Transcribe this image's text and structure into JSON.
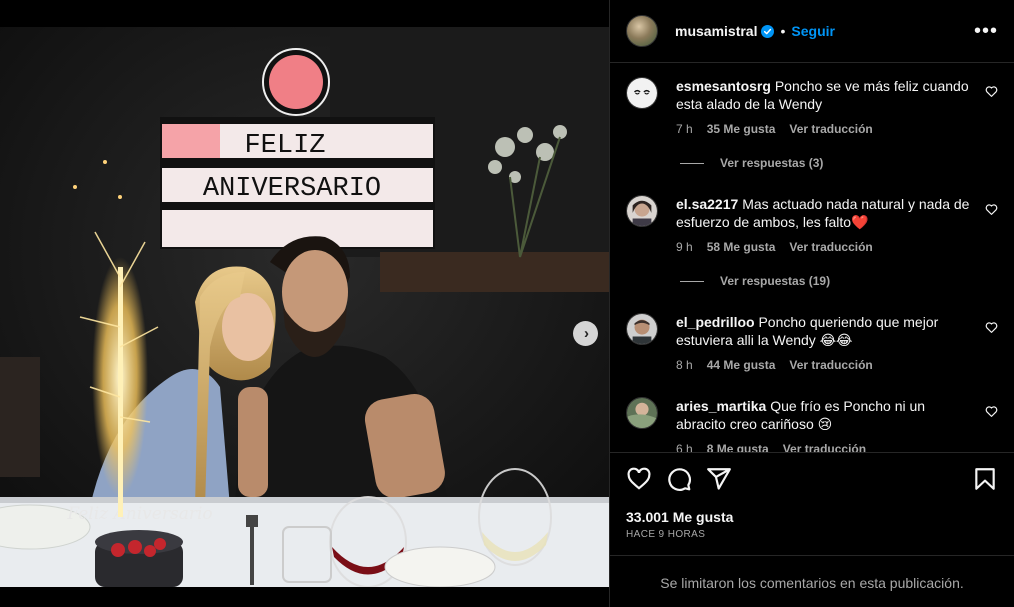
{
  "post": {
    "username": "musamistral",
    "follow_label": "Seguir",
    "dot": "•",
    "more_label": "•••",
    "sign_line1": "FELIZ",
    "sign_line2": "ANIVERSARIO",
    "cake_topper": "Feliz Aniversario",
    "likes": "33.001 Me gusta",
    "time_ago": "HACE 9 HORAS",
    "comments_limited": "Se limitaron los comentarios en esta publicación."
  },
  "comments": [
    {
      "username": "esmesantosrg",
      "text": "Poncho se ve más feliz cuando esta alado de la Wendy",
      "time": "7 h",
      "likes": "35 Me gusta",
      "translate": "Ver traducción",
      "replies": "Ver respuestas (3)"
    },
    {
      "username": "el.sa2217",
      "text": "Mas actuado nada natural y nada de esfuerzo de ambos, les falto❤️",
      "time": "9 h",
      "likes": "58 Me gusta",
      "translate": "Ver traducción",
      "replies": "Ver respuestas (19)"
    },
    {
      "username": "el_pedrilloo",
      "text": "Poncho queriendo que mejor estuviera alli la Wendy 😂😂",
      "time": "8 h",
      "likes": "44 Me gusta",
      "translate": "Ver traducción"
    },
    {
      "username": "aries_martika",
      "text": "Que frío es Poncho ni un abracito creo cariñoso 😢",
      "time": "6 h",
      "likes": "8 Me gusta",
      "translate": "Ver traducción"
    }
  ],
  "icons": {
    "like": "heart-icon",
    "comment": "comment-icon",
    "share": "share-icon",
    "save": "bookmark-icon",
    "next": "chevron-right-icon",
    "verified": "verified-badge-icon"
  },
  "colors": {
    "accent": "#0095f6",
    "background": "#000000",
    "secondary_text": "#a8a8a8",
    "divider": "#262626"
  }
}
